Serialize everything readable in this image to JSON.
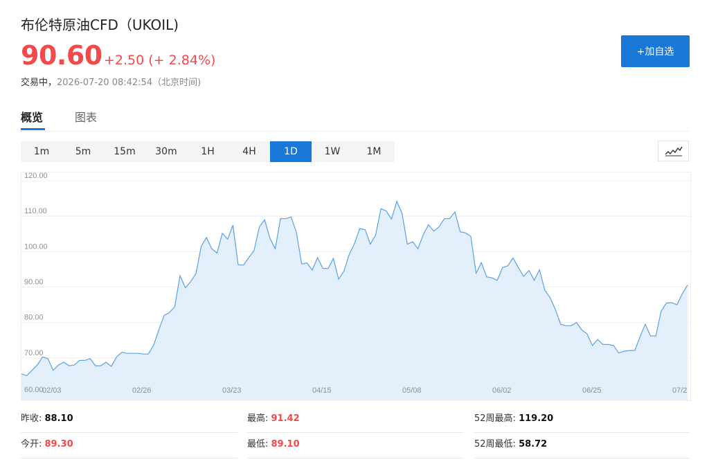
{
  "header": {
    "title": "布伦特原油CFD（UKOIL)",
    "price": "90.60",
    "change": "+2.50 (+ 2.84%)",
    "status_label": "交易中，",
    "timestamp": "2026-07-20 08:42:54（北京时间)",
    "add_watchlist": "+加自选"
  },
  "tabs": [
    {
      "label": "概览",
      "active": true
    },
    {
      "label": "图表",
      "active": false
    }
  ],
  "intervals": [
    "1m",
    "5m",
    "15m",
    "30m",
    "1H",
    "4H",
    "1D",
    "1W",
    "1M"
  ],
  "active_interval": "1D",
  "colors": {
    "accent": "#1a79d8",
    "up": "#f2494b",
    "line": "#5aa0e6",
    "area": "#e3effb"
  },
  "stats": [
    [
      {
        "label": "昨收: ",
        "value": "88.10",
        "color": "black"
      },
      {
        "label": "最高: ",
        "value": "91.42",
        "color": "red"
      },
      {
        "label": "52周最高: ",
        "value": "119.20",
        "color": "black"
      }
    ],
    [
      {
        "label": "今开: ",
        "value": "89.30",
        "color": "red"
      },
      {
        "label": "最低: ",
        "value": "89.10",
        "color": "red"
      },
      {
        "label": "52周最低: ",
        "value": "58.72",
        "color": "black"
      }
    ]
  ],
  "chart_data": {
    "type": "area",
    "title": "",
    "xlabel": "",
    "ylabel": "",
    "ylim": [
      60,
      120
    ],
    "y_ticks": [
      "120.00",
      "110.00",
      "100.00",
      "90.00",
      "80.00",
      "70.00",
      "60.00"
    ],
    "x_ticks": [
      "02/03",
      "02/26",
      "03/23",
      "04/15",
      "05/08",
      "06/02",
      "06/25",
      "07/2"
    ],
    "grid": true,
    "series": [
      {
        "values": [
          65.5,
          65,
          66.5,
          68,
          70.3,
          69.8,
          66.5,
          68,
          68.8,
          67.8,
          68,
          69.3,
          69.3,
          69.8,
          67.8,
          67.8,
          68.8,
          67.6,
          70.3,
          71.6,
          71.3,
          71.3,
          71.3,
          71.1,
          71.1,
          73.6,
          78,
          82,
          82.8,
          84.5,
          93.2,
          89.8,
          91.5,
          93.8,
          101.5,
          104,
          100.8,
          99.6,
          105.2,
          103.5,
          107.5,
          96.3,
          96.2,
          98.3,
          100.3,
          107,
          109,
          103.8,
          100.8,
          109.3,
          109.3,
          109.8,
          105.5,
          96.5,
          96.8,
          94.8,
          98.3,
          95.3,
          95.2,
          98.1,
          92.2,
          94.5,
          99.2,
          102.3,
          106.5,
          106.2,
          102.1,
          104.7,
          112.1,
          111.5,
          109.2,
          114.2,
          110.8,
          102.1,
          102.8,
          100.8,
          104.8,
          107.6,
          105.8,
          107,
          109.3,
          109.3,
          111.2,
          105.6,
          105.3,
          104.3,
          93.9,
          96.9,
          92.9,
          92.6,
          91.9,
          95.5,
          96,
          98.2,
          95.5,
          93,
          94.7,
          91.9,
          94.9,
          89.1,
          87,
          83.7,
          79.5,
          79.1,
          79.1,
          80,
          77.9,
          76.8,
          73.5,
          75.2,
          73.8,
          73.8,
          73.5,
          71.4,
          71.9,
          72.1,
          72.1,
          75.9,
          79.5,
          76.2,
          76.2,
          83.2,
          85.5,
          85.6,
          85,
          88.1,
          90.6
        ]
      }
    ]
  }
}
